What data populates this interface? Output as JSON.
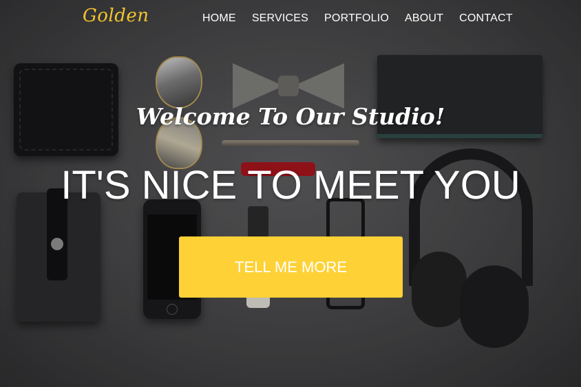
{
  "brand": {
    "logo": "Golden",
    "accent": "#fed136"
  },
  "nav": {
    "items": [
      "HOME",
      "SERVICES",
      "PORTFOLIO",
      "ABOUT",
      "CONTACT"
    ]
  },
  "hero": {
    "subheading": "Welcome To Our Studio!",
    "heading": "IT'S NICE TO MEET YOU",
    "cta_label": "TELL ME MORE"
  },
  "background_objects": [
    "wallet",
    "aviator-sunglasses",
    "bow-tie",
    "pen",
    "notebook",
    "red-pocket-knife",
    "phone-case",
    "smartphone",
    "wristwatch",
    "eyeglasses",
    "headphones"
  ]
}
